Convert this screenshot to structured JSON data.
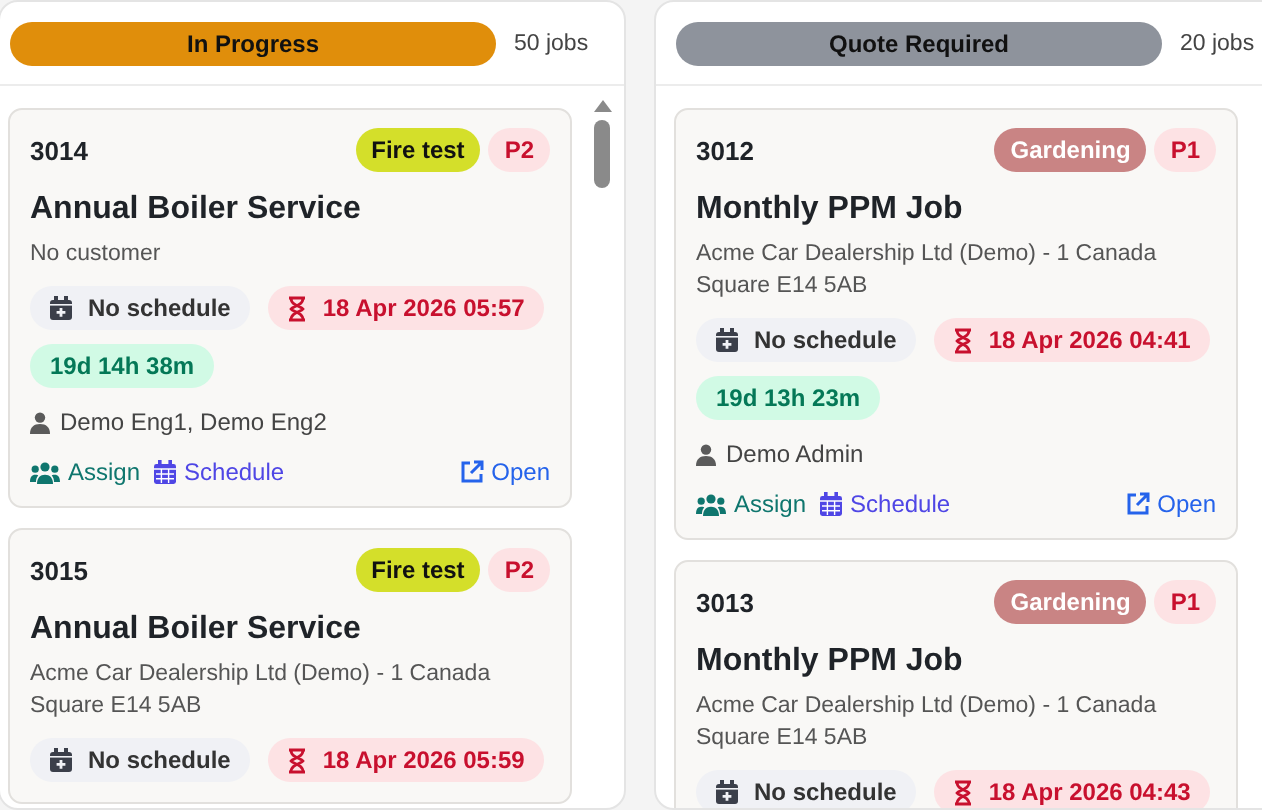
{
  "columns": [
    {
      "status": "In Progress",
      "color": "#e08e0b",
      "count": "50 jobs",
      "cards": [
        {
          "id": "3014",
          "tags": [
            {
              "label": "Fire test",
              "color": "#d4df2a"
            }
          ],
          "priority": "P2",
          "title": "Annual Boiler Service",
          "customer": "No customer",
          "schedule": "No schedule",
          "deadline": "18 Apr 2026 05:57",
          "timer": "19d 14h 38m",
          "assignees": "Demo Eng1, Demo Eng2",
          "actions": [
            {
              "kind": "assign",
              "label": "Assign"
            },
            {
              "kind": "schedule",
              "label": "Schedule"
            },
            {
              "kind": "open",
              "label": "Open"
            }
          ]
        },
        {
          "id": "3015",
          "tags": [
            {
              "label": "Fire test",
              "color": "#d4df2a"
            }
          ],
          "priority": "P2",
          "title": "Annual Boiler Service",
          "customer": "Acme Car Dealership Ltd (Demo) - 1 Canada Square E14 5AB",
          "schedule": "No schedule",
          "deadline": "18 Apr 2026 05:59"
        }
      ]
    },
    {
      "status": "Quote Required",
      "color": "#8e939c",
      "count": "20 jobs",
      "cards": [
        {
          "id": "3012",
          "tags": [
            {
              "label": "Gardening",
              "color": "#c98484"
            }
          ],
          "priority": "P1",
          "title": "Monthly PPM Job",
          "customer": "Acme Car Dealership Ltd (Demo) - 1 Canada Square E14 5AB",
          "schedule": "No schedule",
          "deadline": "18 Apr 2026 04:41",
          "timer": "19d 13h 23m",
          "assignees": "Demo Admin",
          "actions": [
            {
              "kind": "assign",
              "label": "Assign"
            },
            {
              "kind": "schedule",
              "label": "Schedule"
            },
            {
              "kind": "open",
              "label": "Open"
            }
          ]
        },
        {
          "id": "3013",
          "tags": [
            {
              "label": "Gardening",
              "color": "#c98484"
            }
          ],
          "priority": "P1",
          "title": "Monthly PPM Job",
          "customer": "Acme Car Dealership Ltd (Demo) - 1 Canada Square E14 5AB",
          "schedule": "No schedule",
          "deadline": "18 Apr 2026 04:43"
        }
      ]
    }
  ]
}
